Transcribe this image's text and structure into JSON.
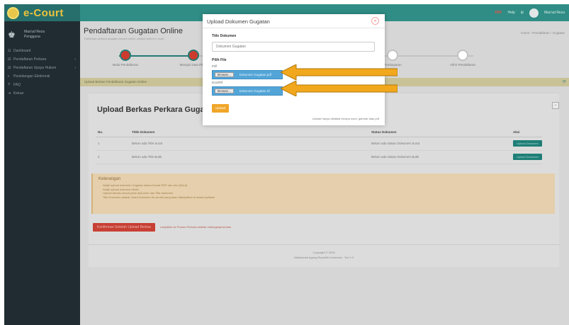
{
  "header": {
    "logo": "e-Court",
    "user_name": "Mas'ud Reza",
    "user_role": "Pengguna",
    "pdf_label": "PDF",
    "help_label": "Help",
    "profile_name": "Mas'ud Reza"
  },
  "sidebar": {
    "items": [
      {
        "icon": "☷",
        "label": "Dashboard",
        "arrow": ""
      },
      {
        "icon": "☑",
        "label": "Pendaftaran Perkara",
        "arrow": "‹"
      },
      {
        "icon": "☑",
        "label": "Pendaftaran Upaya Hukum",
        "arrow": "‹"
      },
      {
        "icon": "▪",
        "label": "Persidangan Elektronik",
        "arrow": ""
      },
      {
        "icon": "?",
        "label": "FAQ",
        "arrow": ""
      },
      {
        "icon": "⇥",
        "label": "Keluar",
        "arrow": ""
      }
    ]
  },
  "page": {
    "title": "Pendaftaran Gugatan Online",
    "subtitle": "Daftarkan perkara gugatan secara online melalui sistem e-court",
    "breadcrumb": "Home › Pendaftaran › Gugatan"
  },
  "steps": [
    {
      "label": "Mulai Pendaftaran",
      "active": true
    },
    {
      "label": "Mengisi Data Pihak",
      "active": true
    },
    {
      "label": "",
      "active": false
    },
    {
      "label": "Pembayaran",
      "active": false
    },
    {
      "label": "Akhir Pendaftaran",
      "active": false
    }
  ],
  "notice": "Upload Berkas Pendaftaran Gugatan Online",
  "section": {
    "title": "Upload Berkas Perkara Gugatan",
    "table": {
      "headers": [
        "No.",
        "Tittle Dokumen",
        "Status Dokumen",
        "Aksi"
      ],
      "rows": [
        {
          "no": "1",
          "title": "Belum ada Title Surat",
          "status": "Belum ada Status Dokumen Surat",
          "action": "Upload Dokumen"
        },
        {
          "no": "2",
          "title": "Belum ada Title Bukti",
          "status": "Belum ada Status Dokumen Bukti",
          "action": "Upload Dokumen"
        }
      ]
    }
  },
  "keterangan": {
    "title": "Keterangan",
    "items": [
      "Wajib upload dokumen Gugatan dalam format PDF dan doc (Word)",
      "Wajib upload dokumen Bukti",
      "Upload berkas sesuai jenis dokumen dan Title dokumen",
      "Title Dokumen adalah Judul Dokumen itu sendiri yang akan ditampilkan di dalam Aplikasi"
    ]
  },
  "buttons": {
    "continue": "Konfirmasi Setelah Upload Berkas",
    "continue_note": "Lanjutkan ke Proses Perkara setelah melengkapi berkas"
  },
  "footer": {
    "line1": "Copyright © 2018",
    "line2": "Mahkamah Agung Republik Indonesia · Ver 1.0"
  },
  "modal": {
    "title": "Upload Dokumen Gugatan",
    "title_label": "Title Dokumen",
    "title_value": "Dokumen Gugatan",
    "file_label": "Pilih File",
    "pdf_label": "Pdf",
    "doc_label": "Doc/Rtf",
    "browse_label": "Browse...",
    "pdf_file": "Dokumen Gugatan.pdf",
    "doc_file": "Dokumen Gugatan.rtf",
    "upload_label": "Upload",
    "note": "Upload hanya dibatasi berupa word, gambar atau pdf"
  },
  "colors": {
    "sidebar_bg": "#202c31",
    "topbar_bg": "#2f8d85",
    "arrow": "#f2a81d",
    "file_input_bg": "#53a5d7"
  }
}
